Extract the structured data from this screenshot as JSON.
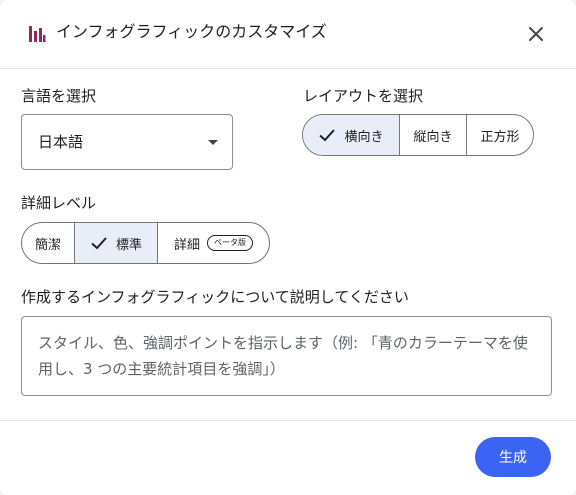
{
  "dialog": {
    "title": "インフォグラフィックのカスタマイズ",
    "icon": "infographic-bars-icon",
    "accent_color": "#8e2a5f",
    "close_icon": "close-icon"
  },
  "language": {
    "label": "言語を選択",
    "selected": "日本語",
    "icon": "chevron-down-icon"
  },
  "layout": {
    "label": "レイアウトを選択",
    "options": [
      {
        "label": "横向き",
        "selected": true
      },
      {
        "label": "縦向き",
        "selected": false
      },
      {
        "label": "正方形",
        "selected": false
      }
    ]
  },
  "detail": {
    "label": "詳細レベル",
    "options": [
      {
        "label": "簡潔",
        "selected": false
      },
      {
        "label": "標準",
        "selected": true
      },
      {
        "label": "詳細",
        "selected": false,
        "badge": "ベータ版"
      }
    ]
  },
  "description": {
    "label": "作成するインフォグラフィックについて説明してください",
    "placeholder": "スタイル、色、強調ポイントを指示します（例: 「青のカラーテーマを使用し、3 つの主要統計項目を強調」）"
  },
  "footer": {
    "generate_label": "生成",
    "button_color": "#3c64f4"
  }
}
